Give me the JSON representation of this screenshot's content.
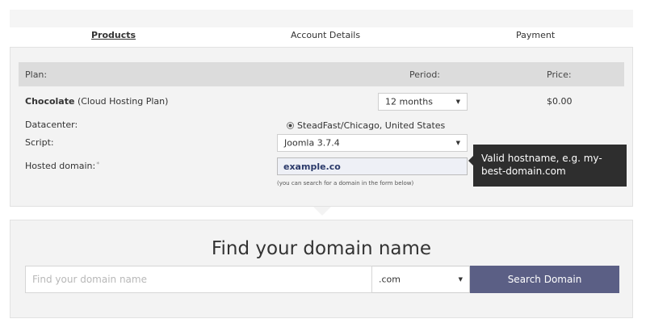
{
  "steps": [
    {
      "label": "Products",
      "active": true
    },
    {
      "label": "Account Details",
      "active": false
    },
    {
      "label": "Payment",
      "active": false
    }
  ],
  "table": {
    "headers": {
      "plan": "Plan:",
      "period": "Period:",
      "price": "Price:"
    },
    "plan_name": "Chocolate",
    "plan_type": " (Cloud Hosting Plan)",
    "period_value": "12 months",
    "price_value": "$0.00"
  },
  "fields": {
    "datacenter_label": "Datacenter:",
    "datacenter_value": "SteadFast/Chicago, United States",
    "script_label": "Script:",
    "script_value": "Joomla 3.7.4",
    "domain_label": "Hosted domain:",
    "domain_required_mark": "*",
    "domain_value": "example.co",
    "domain_hint": "(you can search for a domain in the form below)"
  },
  "tooltip": {
    "text": "Valid hostname, e.g. my-best-domain.com"
  },
  "search": {
    "title": "Find your domain name",
    "placeholder": "Find your domain name",
    "tld_value": ".com",
    "button_label": "Search Domain"
  },
  "colors": {
    "button_bg": "#5b5f85",
    "tooltip_bg": "#2e2e2e",
    "panel_bg": "#f3f3f3",
    "table_header_bg": "#dcdcdc"
  }
}
